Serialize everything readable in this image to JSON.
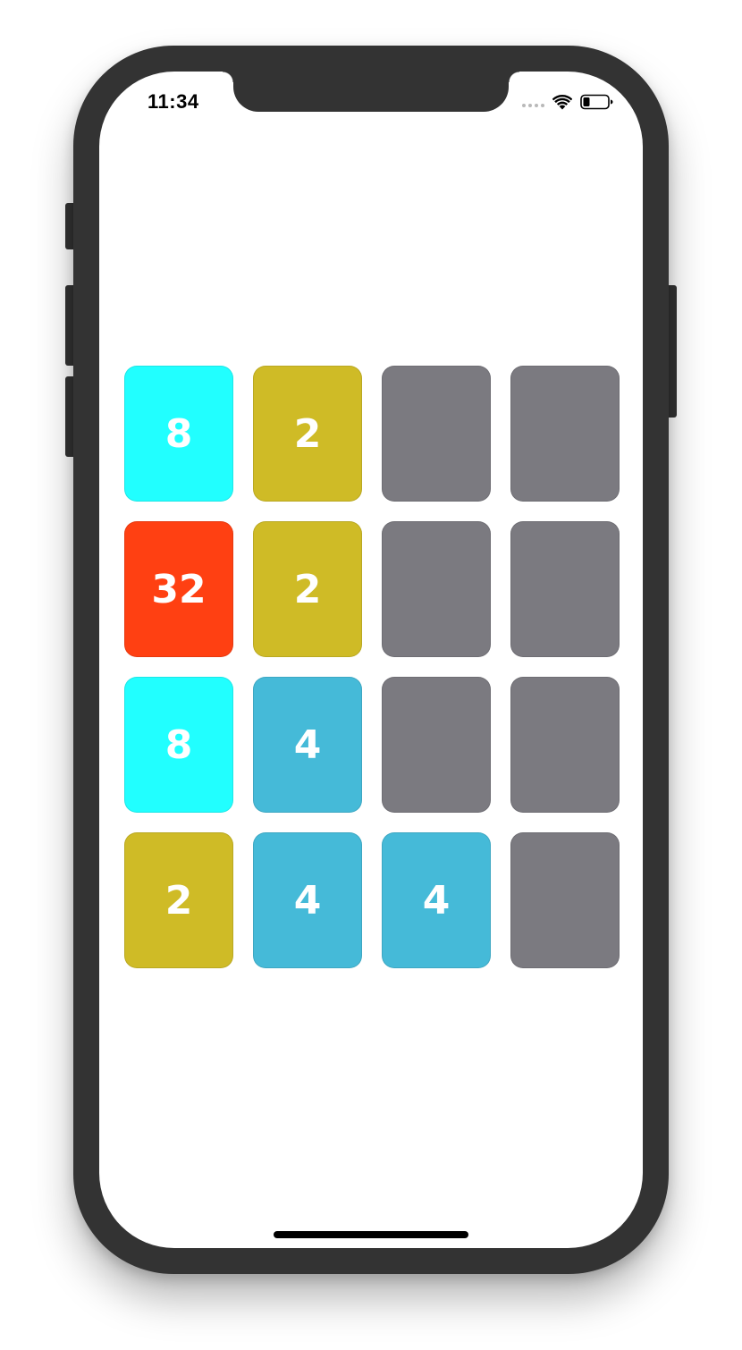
{
  "status_bar": {
    "time": "11:34",
    "icons": [
      "cellular-signal-icon",
      "wifi-icon",
      "battery-icon"
    ]
  },
  "colors": {
    "empty": "#7b7a80",
    "2": "#cfbb26",
    "4": "#45bad8",
    "8": "#21ffff",
    "32": "#ff4012"
  },
  "board": {
    "rows": [
      [
        {
          "value": "8",
          "color": "#21ffff"
        },
        {
          "value": "2",
          "color": "#cfbb26"
        },
        {
          "value": "",
          "color": "#7b7a80"
        },
        {
          "value": "",
          "color": "#7b7a80"
        }
      ],
      [
        {
          "value": "32",
          "color": "#ff4012"
        },
        {
          "value": "2",
          "color": "#cfbb26"
        },
        {
          "value": "",
          "color": "#7b7a80"
        },
        {
          "value": "",
          "color": "#7b7a80"
        }
      ],
      [
        {
          "value": "8",
          "color": "#21ffff"
        },
        {
          "value": "4",
          "color": "#45bad8"
        },
        {
          "value": "",
          "color": "#7b7a80"
        },
        {
          "value": "",
          "color": "#7b7a80"
        }
      ],
      [
        {
          "value": "2",
          "color": "#cfbb26"
        },
        {
          "value": "4",
          "color": "#45bad8"
        },
        {
          "value": "4",
          "color": "#45bad8"
        },
        {
          "value": "",
          "color": "#7b7a80"
        }
      ]
    ]
  }
}
